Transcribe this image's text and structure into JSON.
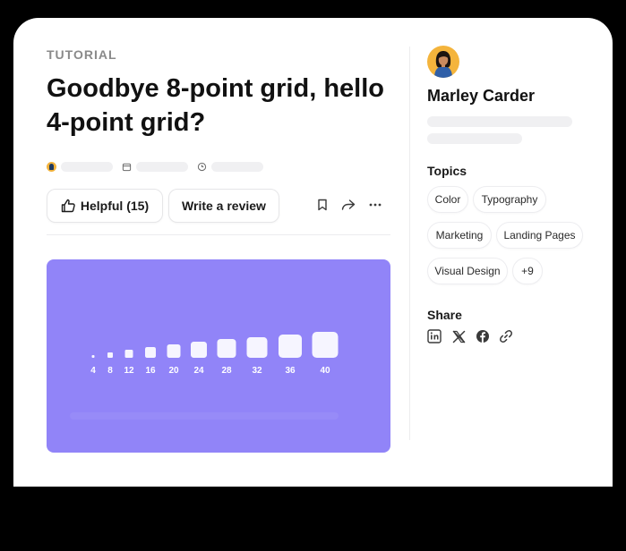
{
  "article": {
    "category": "TUTORIAL",
    "title": "Goodbye 8-point grid, hello 4-point grid?"
  },
  "actions": {
    "helpful_label": "Helpful (15)",
    "review_label": "Write a review",
    "icons": [
      "thumbs-up-icon",
      "bookmark-icon",
      "share-arrow-icon",
      "more-icon"
    ]
  },
  "hero": {
    "background": "#9184f8",
    "grid_sizes": [
      "4",
      "8",
      "12",
      "16",
      "20",
      "24",
      "28",
      "32",
      "36",
      "40"
    ]
  },
  "author": {
    "name": "Marley Carder"
  },
  "topics": {
    "title": "Topics",
    "items": [
      "Color",
      "Typography",
      "Marketing",
      "Landing Pages",
      "Visual Design",
      "+9"
    ]
  },
  "share": {
    "title": "Share",
    "icons": [
      "linkedin-icon",
      "x-icon",
      "facebook-icon",
      "link-icon"
    ]
  },
  "colors": {
    "accent": "#9184f8",
    "text": "#111111",
    "muted": "#8a8a8a",
    "skeleton": "#f0f0f2"
  }
}
